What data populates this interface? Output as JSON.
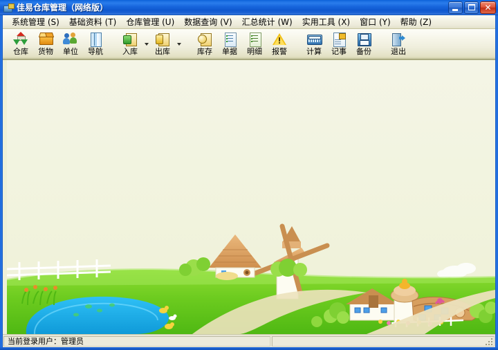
{
  "window": {
    "title": "佳易仓库管理（网络版）",
    "icon": "app-warehouse-icon",
    "buttons": {
      "minimize": "最小化",
      "maximize": "最大化",
      "close": "✕"
    }
  },
  "menubar": {
    "items": [
      {
        "label": "系统管理 (S)"
      },
      {
        "label": "基础资料 (T)"
      },
      {
        "label": "仓库管理 (U)"
      },
      {
        "label": "数据查询 (V)"
      },
      {
        "label": "汇总统计 (W)"
      },
      {
        "label": "实用工具 (X)"
      },
      {
        "label": "窗口 (Y)"
      },
      {
        "label": "帮助 (Z)"
      }
    ]
  },
  "toolbar": {
    "items": [
      {
        "label": "仓库",
        "icon": "warehouse-icon",
        "dropdown": false
      },
      {
        "label": "货物",
        "icon": "goods-box-icon",
        "dropdown": false
      },
      {
        "label": "单位",
        "icon": "people-unit-icon",
        "dropdown": false
      },
      {
        "label": "导航",
        "icon": "navigation-icon",
        "dropdown": false
      },
      {
        "label": "入库",
        "icon": "stock-in-icon",
        "dropdown": true
      },
      {
        "label": "出库",
        "icon": "stock-out-icon",
        "dropdown": true
      },
      {
        "label": "库存",
        "icon": "inventory-icon",
        "dropdown": false
      },
      {
        "label": "单据",
        "icon": "document-icon",
        "dropdown": false
      },
      {
        "label": "明细",
        "icon": "detail-list-icon",
        "dropdown": false
      },
      {
        "label": "报警",
        "icon": "alarm-warning-icon",
        "dropdown": false
      },
      {
        "label": "计算",
        "icon": "calculator-icon",
        "dropdown": false
      },
      {
        "label": "记事",
        "icon": "notepad-icon",
        "dropdown": false
      },
      {
        "label": "备份",
        "icon": "backup-floppy-icon",
        "dropdown": false
      },
      {
        "label": "退出",
        "icon": "exit-door-icon",
        "dropdown": false
      }
    ]
  },
  "client": {
    "background_art": "cartoon-farm-scene",
    "colors": {
      "sky": "#f2f3e0",
      "grass": "#5cc21a",
      "grass_light": "#8fe03c",
      "pond": "#1fb3ef",
      "path": "#ece3c0",
      "roof": "#d99a5c",
      "wall": "#fdfdf8"
    }
  },
  "statusbar": {
    "panels": [
      {
        "text": "当前登录用户：管理员"
      },
      {
        "text": ""
      }
    ],
    "grip": "resize-grip"
  }
}
